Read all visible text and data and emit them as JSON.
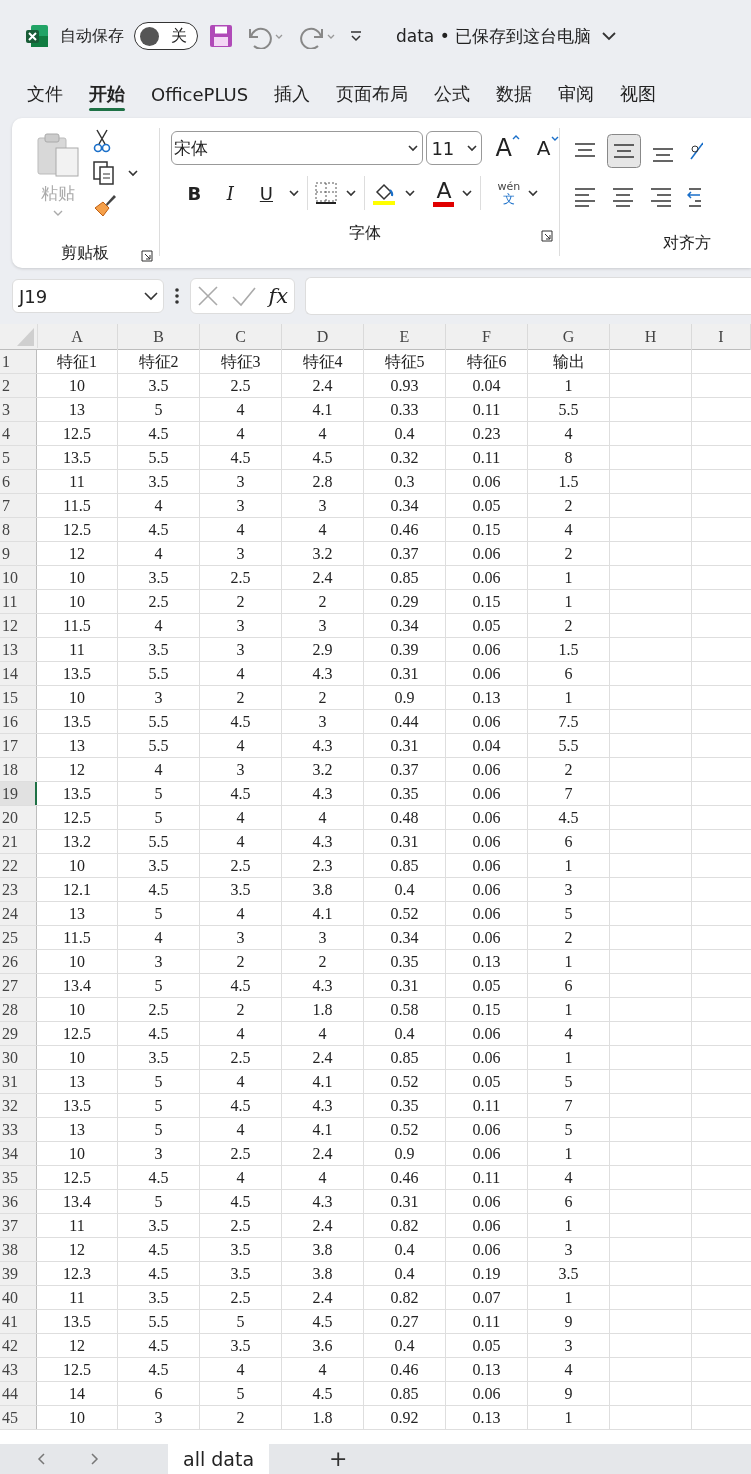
{
  "title_bar": {
    "autosave_label": "自动保存",
    "autosave": {
      "label": "关",
      "on": false
    },
    "title": "data • 已保存到这台电脑"
  },
  "menu_tabs": [
    {
      "label": "文件",
      "selected": false
    },
    {
      "label": "开始",
      "selected": true
    },
    {
      "label": "OfficePLUS",
      "selected": false
    },
    {
      "label": "插入",
      "selected": false
    },
    {
      "label": "页面布局",
      "selected": false
    },
    {
      "label": "公式",
      "selected": false
    },
    {
      "label": "数据",
      "selected": false
    },
    {
      "label": "审阅",
      "selected": false
    },
    {
      "label": "视图",
      "selected": false
    }
  ],
  "ribbon": {
    "paste_label": "粘贴",
    "font_name": "宋体",
    "font_size": "11",
    "grow_font": "A",
    "shrink_font": "A",
    "bold": "B",
    "italic": "I",
    "underline": "U",
    "font_color": "A",
    "phonetic_top": "wén",
    "phonetic_bottom": "文",
    "groups": [
      "剪贴板",
      "字体",
      "对齐方"
    ]
  },
  "formula_bar": {
    "name_box": "J19",
    "function_label": "fx"
  },
  "sheet": {
    "columns": [
      "A",
      "B",
      "C",
      "D",
      "E",
      "F",
      "G",
      "H",
      "I"
    ],
    "rows": [
      {
        "number": "1",
        "selected": false,
        "cells": [
          "特征1",
          "特征2",
          "特征3",
          "特征4",
          "特征5",
          "特征6",
          "输出"
        ]
      },
      {
        "number": "2",
        "selected": false,
        "cells": [
          "10",
          "3.5",
          "2.5",
          "2.4",
          "0.93",
          "0.04",
          "1"
        ]
      },
      {
        "number": "3",
        "selected": false,
        "cells": [
          "13",
          "5",
          "4",
          "4.1",
          "0.33",
          "0.11",
          "5.5"
        ]
      },
      {
        "number": "4",
        "selected": false,
        "cells": [
          "12.5",
          "4.5",
          "4",
          "4",
          "0.4",
          "0.23",
          "4"
        ]
      },
      {
        "number": "5",
        "selected": false,
        "cells": [
          "13.5",
          "5.5",
          "4.5",
          "4.5",
          "0.32",
          "0.11",
          "8"
        ]
      },
      {
        "number": "6",
        "selected": false,
        "cells": [
          "11",
          "3.5",
          "3",
          "2.8",
          "0.3",
          "0.06",
          "1.5"
        ]
      },
      {
        "number": "7",
        "selected": false,
        "cells": [
          "11.5",
          "4",
          "3",
          "3",
          "0.34",
          "0.05",
          "2"
        ]
      },
      {
        "number": "8",
        "selected": false,
        "cells": [
          "12.5",
          "4.5",
          "4",
          "4",
          "0.46",
          "0.15",
          "4"
        ]
      },
      {
        "number": "9",
        "selected": false,
        "cells": [
          "12",
          "4",
          "3",
          "3.2",
          "0.37",
          "0.06",
          "2"
        ]
      },
      {
        "number": "10",
        "selected": false,
        "cells": [
          "10",
          "3.5",
          "2.5",
          "2.4",
          "0.85",
          "0.06",
          "1"
        ]
      },
      {
        "number": "11",
        "selected": false,
        "cells": [
          "10",
          "2.5",
          "2",
          "2",
          "0.29",
          "0.15",
          "1"
        ]
      },
      {
        "number": "12",
        "selected": false,
        "cells": [
          "11.5",
          "4",
          "3",
          "3",
          "0.34",
          "0.05",
          "2"
        ]
      },
      {
        "number": "13",
        "selected": false,
        "cells": [
          "11",
          "3.5",
          "3",
          "2.9",
          "0.39",
          "0.06",
          "1.5"
        ]
      },
      {
        "number": "14",
        "selected": false,
        "cells": [
          "13.5",
          "5.5",
          "4",
          "4.3",
          "0.31",
          "0.06",
          "6"
        ]
      },
      {
        "number": "15",
        "selected": false,
        "cells": [
          "10",
          "3",
          "2",
          "2",
          "0.9",
          "0.13",
          "1"
        ]
      },
      {
        "number": "16",
        "selected": false,
        "cells": [
          "13.5",
          "5.5",
          "4.5",
          "3",
          "0.44",
          "0.06",
          "7.5"
        ]
      },
      {
        "number": "17",
        "selected": false,
        "cells": [
          "13",
          "5.5",
          "4",
          "4.3",
          "0.31",
          "0.04",
          "5.5"
        ]
      },
      {
        "number": "18",
        "selected": false,
        "cells": [
          "12",
          "4",
          "3",
          "3.2",
          "0.37",
          "0.06",
          "2"
        ]
      },
      {
        "number": "19",
        "selected": true,
        "cells": [
          "13.5",
          "5",
          "4.5",
          "4.3",
          "0.35",
          "0.06",
          "7"
        ]
      },
      {
        "number": "20",
        "selected": false,
        "cells": [
          "12.5",
          "5",
          "4",
          "4",
          "0.48",
          "0.06",
          "4.5"
        ]
      },
      {
        "number": "21",
        "selected": false,
        "cells": [
          "13.2",
          "5.5",
          "4",
          "4.3",
          "0.31",
          "0.06",
          "6"
        ]
      },
      {
        "number": "22",
        "selected": false,
        "cells": [
          "10",
          "3.5",
          "2.5",
          "2.3",
          "0.85",
          "0.06",
          "1"
        ]
      },
      {
        "number": "23",
        "selected": false,
        "cells": [
          "12.1",
          "4.5",
          "3.5",
          "3.8",
          "0.4",
          "0.06",
          "3"
        ]
      },
      {
        "number": "24",
        "selected": false,
        "cells": [
          "13",
          "5",
          "4",
          "4.1",
          "0.52",
          "0.06",
          "5"
        ]
      },
      {
        "number": "25",
        "selected": false,
        "cells": [
          "11.5",
          "4",
          "3",
          "3",
          "0.34",
          "0.06",
          "2"
        ]
      },
      {
        "number": "26",
        "selected": false,
        "cells": [
          "10",
          "3",
          "2",
          "2",
          "0.35",
          "0.13",
          "1"
        ]
      },
      {
        "number": "27",
        "selected": false,
        "cells": [
          "13.4",
          "5",
          "4.5",
          "4.3",
          "0.31",
          "0.05",
          "6"
        ]
      },
      {
        "number": "28",
        "selected": false,
        "cells": [
          "10",
          "2.5",
          "2",
          "1.8",
          "0.58",
          "0.15",
          "1"
        ]
      },
      {
        "number": "29",
        "selected": false,
        "cells": [
          "12.5",
          "4.5",
          "4",
          "4",
          "0.4",
          "0.06",
          "4"
        ]
      },
      {
        "number": "30",
        "selected": false,
        "cells": [
          "10",
          "3.5",
          "2.5",
          "2.4",
          "0.85",
          "0.06",
          "1"
        ]
      },
      {
        "number": "31",
        "selected": false,
        "cells": [
          "13",
          "5",
          "4",
          "4.1",
          "0.52",
          "0.05",
          "5"
        ]
      },
      {
        "number": "32",
        "selected": false,
        "cells": [
          "13.5",
          "5",
          "4.5",
          "4.3",
          "0.35",
          "0.11",
          "7"
        ]
      },
      {
        "number": "33",
        "selected": false,
        "cells": [
          "13",
          "5",
          "4",
          "4.1",
          "0.52",
          "0.06",
          "5"
        ]
      },
      {
        "number": "34",
        "selected": false,
        "cells": [
          "10",
          "3",
          "2.5",
          "2.4",
          "0.9",
          "0.06",
          "1"
        ]
      },
      {
        "number": "35",
        "selected": false,
        "cells": [
          "12.5",
          "4.5",
          "4",
          "4",
          "0.46",
          "0.11",
          "4"
        ]
      },
      {
        "number": "36",
        "selected": false,
        "cells": [
          "13.4",
          "5",
          "4.5",
          "4.3",
          "0.31",
          "0.06",
          "6"
        ]
      },
      {
        "number": "37",
        "selected": false,
        "cells": [
          "11",
          "3.5",
          "2.5",
          "2.4",
          "0.82",
          "0.06",
          "1"
        ]
      },
      {
        "number": "38",
        "selected": false,
        "cells": [
          "12",
          "4.5",
          "3.5",
          "3.8",
          "0.4",
          "0.06",
          "3"
        ]
      },
      {
        "number": "39",
        "selected": false,
        "cells": [
          "12.3",
          "4.5",
          "3.5",
          "3.8",
          "0.4",
          "0.19",
          "3.5"
        ]
      },
      {
        "number": "40",
        "selected": false,
        "cells": [
          "11",
          "3.5",
          "2.5",
          "2.4",
          "0.82",
          "0.07",
          "1"
        ]
      },
      {
        "number": "41",
        "selected": false,
        "cells": [
          "13.5",
          "5.5",
          "5",
          "4.5",
          "0.27",
          "0.11",
          "9"
        ]
      },
      {
        "number": "42",
        "selected": false,
        "cells": [
          "12",
          "4.5",
          "3.5",
          "3.6",
          "0.4",
          "0.05",
          "3"
        ]
      },
      {
        "number": "43",
        "selected": false,
        "cells": [
          "12.5",
          "4.5",
          "4",
          "4",
          "0.46",
          "0.13",
          "4"
        ]
      },
      {
        "number": "44",
        "selected": false,
        "cells": [
          "14",
          "6",
          "5",
          "4.5",
          "0.85",
          "0.06",
          "9"
        ]
      },
      {
        "number": "45",
        "selected": false,
        "cells": [
          "10",
          "3",
          "2",
          "1.8",
          "0.92",
          "0.13",
          "1"
        ]
      }
    ]
  },
  "sheet_tabs": [
    {
      "label": "all data",
      "selected": true
    }
  ],
  "add_sheet": "+"
}
